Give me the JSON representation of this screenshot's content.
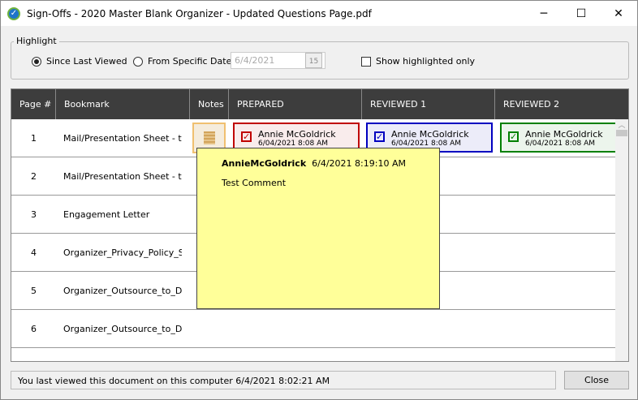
{
  "window": {
    "title": "Sign-Offs - 2020 Master Blank Organizer - Updated Questions Page.pdf"
  },
  "highlight": {
    "label": "Highlight",
    "since_last": "Since Last Viewed",
    "from_date": "From Specific Date",
    "date_value": "6/4/2021",
    "calendar_day": "15",
    "show_only": "Show highlighted only"
  },
  "columns": [
    "Page #",
    "Bookmark",
    "Notes",
    "PREPARED",
    "REVIEWED 1",
    "REVIEWED 2"
  ],
  "rows": [
    {
      "page": "1",
      "bookmark": "Mail/Presentation Sheet - to ta"
    },
    {
      "page": "2",
      "bookmark": "Mail/Presentation Sheet - to p"
    },
    {
      "page": "3",
      "bookmark": "Engagement Letter"
    },
    {
      "page": "4",
      "bookmark": "Organizer_Privacy_Policy_Stan"
    },
    {
      "page": "5",
      "bookmark": "Organizer_Outsource_to_Data"
    },
    {
      "page": "6",
      "bookmark": "Organizer_Outsource_to_Data"
    }
  ],
  "signoffs": [
    {
      "name": "Annie McGoldrick",
      "date": "6/04/2021 8:08 AM",
      "color": "#c00000",
      "bg": "#f9ecec"
    },
    {
      "name": "Annie McGoldrick",
      "date": "6/04/2021 8:08 AM",
      "color": "#0000c0",
      "bg": "#ececf9"
    },
    {
      "name": "Annie McGoldrick",
      "date": "6/04/2021 8:08 AM",
      "color": "#008000",
      "bg": "#ecf5ec"
    }
  ],
  "tooltip": {
    "author": "AnnieMcGoldrick",
    "timestamp": "6/4/2021 8:19:10 AM",
    "comment": "Test Comment"
  },
  "status": "You last viewed this document on this computer 6/4/2021 8:02:21 AM",
  "close_label": "Close"
}
